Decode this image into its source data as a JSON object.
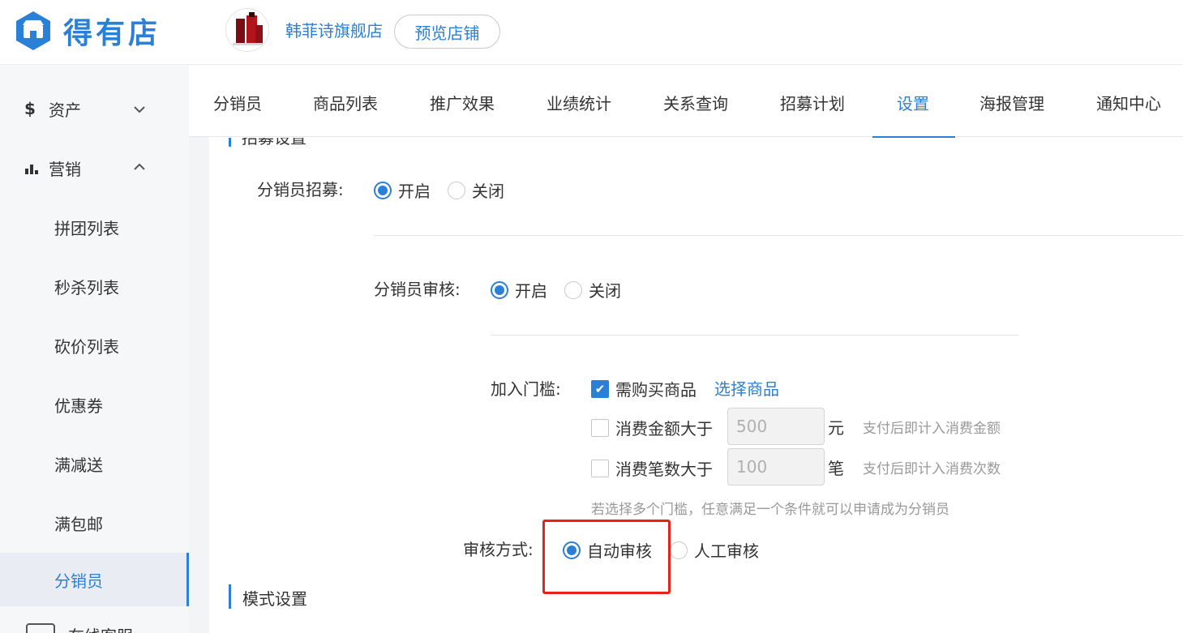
{
  "brand": {
    "name": "得有店",
    "color": "#2a7fd6"
  },
  "store": {
    "name": "韩菲诗旗舰店",
    "preview_label": "预览店铺"
  },
  "sidebar": {
    "groups": [
      {
        "icon": "$",
        "label": "资产",
        "chevron": "⌄"
      },
      {
        "icon": "bar-chart-icon",
        "label": "营销",
        "chevron": "⌃"
      }
    ],
    "items": [
      {
        "label": "拼团列表"
      },
      {
        "label": "秒杀列表"
      },
      {
        "label": "砍价列表"
      },
      {
        "label": "优惠券"
      },
      {
        "label": "满减送"
      },
      {
        "label": "满包邮"
      },
      {
        "label": "分销员",
        "active": true
      }
    ],
    "partial_item": "在线客服"
  },
  "tabs": [
    {
      "label": "分销员"
    },
    {
      "label": "商品列表"
    },
    {
      "label": "推广效果"
    },
    {
      "label": "业绩统计"
    },
    {
      "label": "关系查询"
    },
    {
      "label": "招募计划"
    },
    {
      "label": "设置",
      "active": true
    },
    {
      "label": "海报管理"
    },
    {
      "label": "通知中心"
    }
  ],
  "sections": {
    "recruit_title": "招募设置",
    "mode_title": "模式设置"
  },
  "recruit": {
    "label": "分销员招募:",
    "options": {
      "on": "开启",
      "off": "关闭"
    },
    "selected": "on"
  },
  "review": {
    "label": "分销员审核:",
    "options": {
      "on": "开启",
      "off": "关闭"
    },
    "selected": "on"
  },
  "threshold": {
    "label": "加入门槛:",
    "buy_product": {
      "label": "需购买商品",
      "checked": true,
      "link": "选择商品"
    },
    "spend_amount": {
      "label": "消费金额大于",
      "checked": false,
      "value": "500",
      "unit": "元",
      "hint": "支付后即计入消费金额"
    },
    "spend_count": {
      "label": "消费笔数大于",
      "checked": false,
      "value": "100",
      "unit": "笔",
      "hint": "支付后即计入消费次数"
    },
    "note": "若选择多个门槛，任意满足一个条件就可以申请成为分销员"
  },
  "review_method": {
    "label": "审核方式:",
    "options": {
      "auto": "自动审核",
      "manual": "人工审核"
    },
    "selected": "auto"
  },
  "colors": {
    "accent": "#2a7fd6",
    "highlight": "#e8211b"
  }
}
